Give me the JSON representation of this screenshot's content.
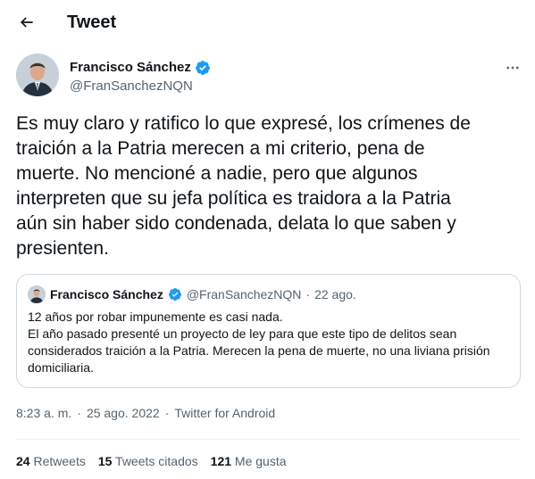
{
  "header": {
    "title": "Tweet"
  },
  "author": {
    "name": "Francisco Sánchez",
    "handle": "@FranSanchezNQN",
    "verified_color": "#1d9bf0"
  },
  "tweet": {
    "text": "Es muy claro y ratifico lo que expresé, los crímenes de\ntraición a la Patria merecen a mi criterio, pena de\nmuerte. No mencioné a nadie, pero que algunos\ninterpreten que su jefa política es traidora a la Patria\naún sin haber sido condenada, delata lo que saben y\npresienten."
  },
  "quoted": {
    "name": "Francisco Sánchez",
    "handle": "@FranSanchezNQN",
    "separator": "·",
    "date": "22 ago.",
    "line1": "12 años por robar impunemente es casi nada.",
    "line2": "El año pasado presenté un proyecto de ley para que este tipo de delitos sean considerados traición a la Patria. Merecen la pena de muerte, no una liviana prisión domiciliaria."
  },
  "meta": {
    "time": "8:23 a. m.",
    "separator": "·",
    "date": "25 ago. 2022",
    "source": "Twitter for Android"
  },
  "stats": {
    "retweets_count": "24",
    "retweets_label": "Retweets",
    "quotes_count": "15",
    "quotes_label": "Tweets citados",
    "likes_count": "121",
    "likes_label": "Me gusta"
  }
}
